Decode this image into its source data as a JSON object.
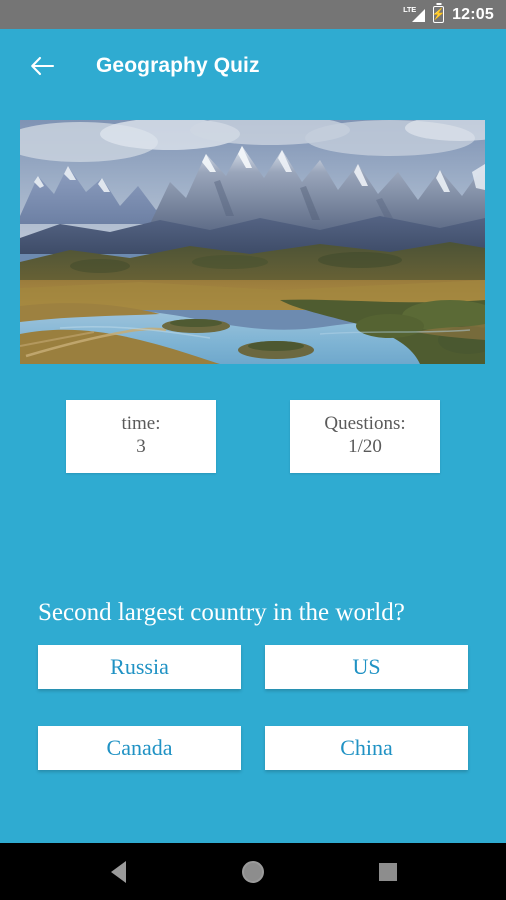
{
  "status_bar": {
    "network_label": "LTE",
    "signal_icon": "signal-bars-icon",
    "battery_icon": "battery-charging-icon",
    "time": "12:05",
    "background_color": "#757575"
  },
  "app_bar": {
    "back_icon": "arrow-left-icon",
    "title": "Geography Quiz",
    "background_color": "#2FABD1"
  },
  "hero": {
    "image_name": "patagonia-mountain-river-landscape",
    "alt": "Snow-capped mountain range above a winding blue river and golden grassland"
  },
  "stats": {
    "time_card": {
      "label": "time:",
      "value": "3"
    },
    "questions_card": {
      "label": "Questions:",
      "value": "1/20"
    }
  },
  "quiz": {
    "question": "Second largest country in the world?",
    "answers": [
      {
        "label": "Russia"
      },
      {
        "label": "US"
      },
      {
        "label": "Canada"
      },
      {
        "label": "China"
      }
    ],
    "answer_text_color": "#2092C4",
    "card_background": "#ffffff"
  },
  "nav_bar": {
    "back_icon": "triangle-back-icon",
    "home_icon": "circle-home-icon",
    "recents_icon": "square-recents-icon",
    "background_color": "#000000"
  }
}
